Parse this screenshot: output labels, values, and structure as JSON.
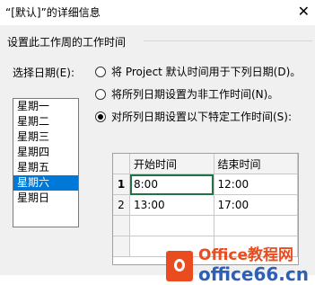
{
  "window": {
    "title": "“[默认]”的详细信息",
    "close_glyph": "✕"
  },
  "group": {
    "label": "设置此工作周的工作时间"
  },
  "day_list": {
    "label": "选择日期(E):",
    "items": [
      "星期一",
      "星期二",
      "星期三",
      "星期四",
      "星期五",
      "星期六",
      "星期日"
    ],
    "selected": "星期六"
  },
  "options": [
    {
      "label": "将 Project 默认时间用于下列日期(D)。",
      "checked": false
    },
    {
      "label": "将所列日期设置为非工作时间(N)。",
      "checked": false
    },
    {
      "label": "对所列日期设置以下特定工作时间(S):",
      "checked": true
    }
  ],
  "hours_table": {
    "headers": [
      "开始时间",
      "结束时间"
    ],
    "rows": [
      {
        "num": "1",
        "start": "8:00",
        "end": "12:00"
      },
      {
        "num": "2",
        "start": "13:00",
        "end": "17:00"
      }
    ]
  },
  "watermark": {
    "line1": "Office教程网",
    "line2": "office66.cn"
  }
}
